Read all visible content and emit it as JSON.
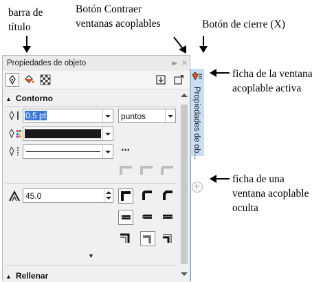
{
  "annotations": {
    "title_bar": [
      "barra de",
      "título"
    ],
    "collapse_button": [
      "Botón Contraer",
      "ventanas acoplables"
    ],
    "close_button": "Botón de cierre (X)",
    "active_tab": [
      "ficha de la ventana",
      "acoplable activa"
    ],
    "hidden_tab": [
      "ficha de una",
      "ventana acoplable",
      "oculta"
    ]
  },
  "docker": {
    "title": "Propiedades de objeto",
    "collapse_glyph": "▸▸",
    "close_glyph": "✕",
    "contour_section": "Contorno",
    "width_value": "0.5 pt",
    "units_value": "puntos",
    "miter_value": "45.0",
    "fill_section": "Rellenar",
    "more_glyph": "▼",
    "dots": "···"
  },
  "tabstrip": {
    "active_tab_label": "Propiedades de ob...",
    "add_glyph": "+"
  },
  "colors": {
    "selection": "#3b78d8",
    "tab_active": "#c9ddf3",
    "outline_color": "#1a1a1a"
  }
}
